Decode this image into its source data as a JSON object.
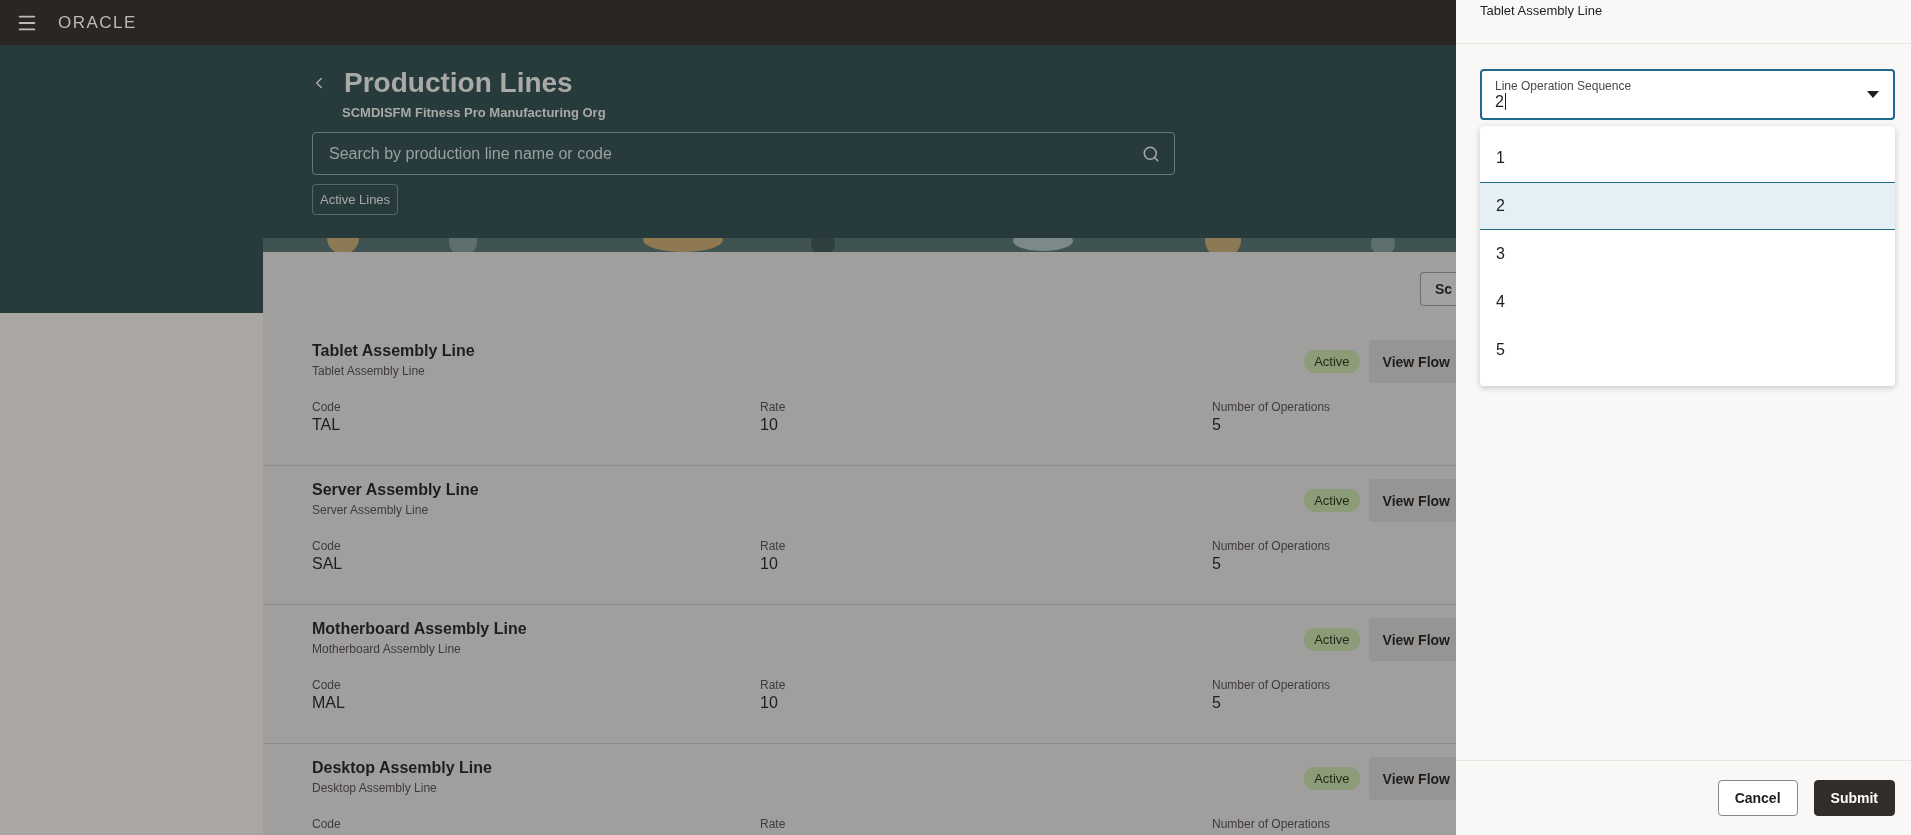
{
  "header": {
    "logo": "ORACLE"
  },
  "page": {
    "title": "Production Lines",
    "subtitle": "SCMDISFM Fitness Pro Manufacturing Org",
    "search": {
      "placeholder": "Search by production line name or code"
    },
    "filters": [
      "Active Lines"
    ],
    "toolbar_button": "Sc"
  },
  "lines": [
    {
      "name": "Tablet Assembly Line",
      "description": "Tablet Assembly Line",
      "status": "Active",
      "action": "View Flow",
      "fields": [
        {
          "label": "Code",
          "value": "TAL"
        },
        {
          "label": "Rate",
          "value": "10"
        },
        {
          "label": "Number of Operations",
          "value": "5"
        }
      ]
    },
    {
      "name": "Server Assembly Line",
      "description": "Server Assembly Line",
      "status": "Active",
      "action": "View Flow",
      "fields": [
        {
          "label": "Code",
          "value": "SAL"
        },
        {
          "label": "Rate",
          "value": "10"
        },
        {
          "label": "Number of Operations",
          "value": "5"
        }
      ]
    },
    {
      "name": "Motherboard Assembly Line",
      "description": "Motherboard Assembly Line",
      "status": "Active",
      "action": "View Flow",
      "fields": [
        {
          "label": "Code",
          "value": "MAL"
        },
        {
          "label": "Rate",
          "value": "10"
        },
        {
          "label": "Number of Operations",
          "value": "5"
        }
      ]
    },
    {
      "name": "Desktop Assembly Line",
      "description": "Desktop Assembly Line",
      "status": "Active",
      "action": "View Flow",
      "fields": [
        {
          "label": "Code"
        },
        {
          "label": "Rate"
        },
        {
          "label": "Number of Operations"
        }
      ]
    }
  ],
  "drawer": {
    "title": "Tablet Assembly Line",
    "field": {
      "label": "Line Operation Sequence",
      "value": "2",
      "expanded": true
    },
    "options": [
      {
        "label": "1",
        "selected": false
      },
      {
        "label": "2",
        "selected": true
      },
      {
        "label": "3",
        "selected": false
      },
      {
        "label": "4",
        "selected": false
      },
      {
        "label": "5",
        "selected": false
      }
    ],
    "buttons": [
      {
        "label": "Cancel",
        "kind": "secondary"
      },
      {
        "label": "Submit",
        "kind": "primary"
      }
    ]
  }
}
